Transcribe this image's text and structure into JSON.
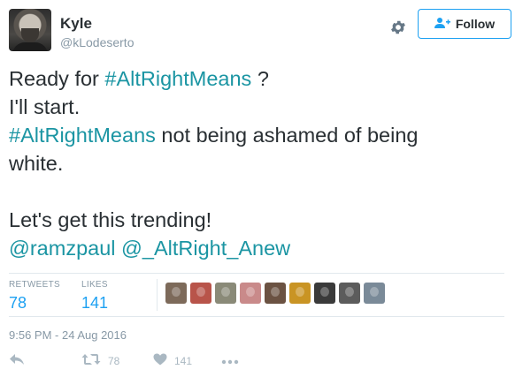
{
  "user": {
    "name": "Kyle",
    "handle": "@kLodeserto"
  },
  "header": {
    "follow_label": "Follow",
    "follow_icon": "add-user-icon",
    "settings_icon": "gear-icon"
  },
  "tweet": {
    "lines": [
      {
        "segments": [
          {
            "text": "Ready for "
          },
          {
            "text": "#AltRightMeans",
            "link": true
          },
          {
            "text": " ?"
          }
        ]
      },
      {
        "segments": [
          {
            "text": "I'll start."
          }
        ]
      },
      {
        "segments": [
          {
            "text": "#AltRightMeans",
            "link": true
          },
          {
            "text": " not being ashamed of being"
          }
        ]
      },
      {
        "segments": [
          {
            "text": "white."
          }
        ]
      },
      {
        "segments": []
      },
      {
        "segments": [
          {
            "text": "Let's get this trending!"
          }
        ]
      },
      {
        "segments": [
          {
            "text": "@ramzpaul",
            "link": true
          },
          {
            "text": " "
          },
          {
            "text": "@_AltRight_Anew",
            "link": true
          }
        ]
      }
    ]
  },
  "stats": {
    "retweets_label": "RETWEETS",
    "retweets_value": "78",
    "likes_label": "LIKES",
    "likes_value": "141"
  },
  "likers": [
    {
      "bg": "#7d6a5a"
    },
    {
      "bg": "#b8544a"
    },
    {
      "bg": "#8a8a78"
    },
    {
      "bg": "#c98a8a"
    },
    {
      "bg": "#6b5242"
    },
    {
      "bg": "#c99424"
    },
    {
      "bg": "#3a3a3a"
    },
    {
      "bg": "#5c5c5c"
    },
    {
      "bg": "#7a8a98"
    }
  ],
  "timestamp": "9:56 PM - 24 Aug 2016",
  "actions": {
    "reply_icon": "reply-icon",
    "retweet_icon": "retweet-icon",
    "retweet_count": "78",
    "like_icon": "heart-icon",
    "like_count": "141",
    "more_icon": "more-icon"
  },
  "colors": {
    "link": "#1b95a3",
    "accent": "#1da1f2",
    "muted": "#8899a6"
  }
}
